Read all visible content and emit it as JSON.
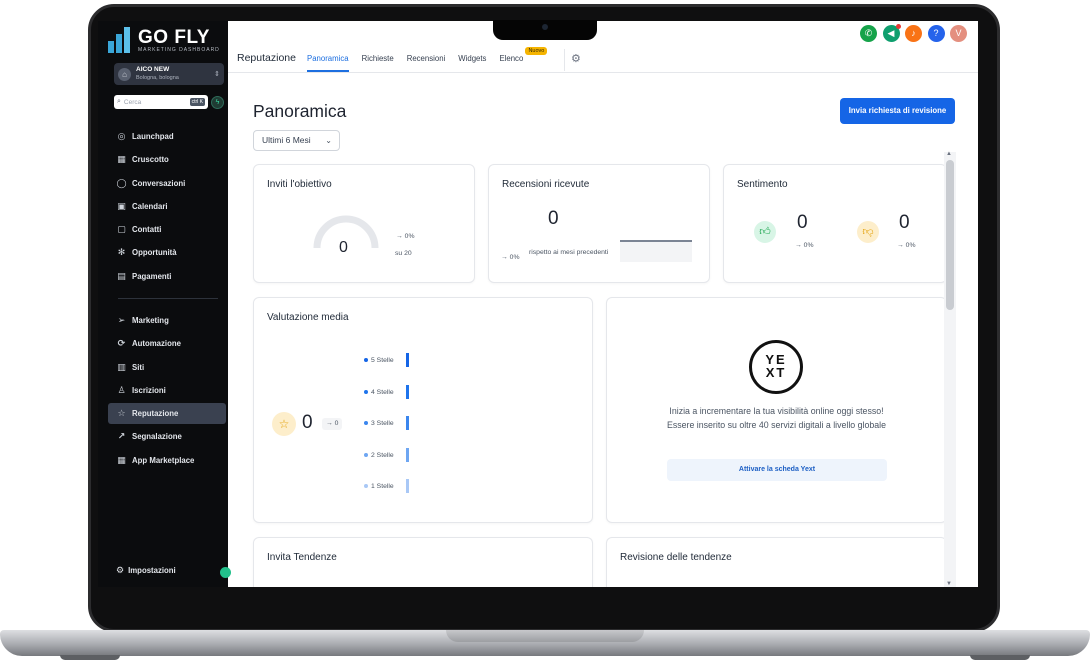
{
  "brand": {
    "title": "GO FLY",
    "subtitle": "MARKETING DASHBOARD"
  },
  "account": {
    "name": "AICO NEW",
    "location": "Bologna, bologna"
  },
  "search": {
    "placeholder": "Cerca",
    "shortcut": "ctrl K"
  },
  "sidebar": {
    "items": [
      {
        "label": "Launchpad",
        "icon": "launchpad-icon"
      },
      {
        "label": "Cruscotto",
        "icon": "dashboard-icon"
      },
      {
        "label": "Conversazioni",
        "icon": "chat-icon"
      },
      {
        "label": "Calendari",
        "icon": "calendar-icon"
      },
      {
        "label": "Contatti",
        "icon": "contacts-icon"
      },
      {
        "label": "Opportunità",
        "icon": "opportunity-icon"
      },
      {
        "label": "Pagamenti",
        "icon": "payments-icon"
      },
      {
        "label": "Marketing",
        "icon": "send-icon"
      },
      {
        "label": "Automazione",
        "icon": "automation-icon"
      },
      {
        "label": "Siti",
        "icon": "sites-icon"
      },
      {
        "label": "Iscrizioni",
        "icon": "memberships-icon"
      },
      {
        "label": "Reputazione",
        "icon": "star-icon",
        "active": true
      },
      {
        "label": "Segnalazione",
        "icon": "reporting-icon"
      },
      {
        "label": "App Marketplace",
        "icon": "apps-icon"
      }
    ],
    "settings_label": "Impostazioni"
  },
  "topbar": {
    "title": "Reputazione",
    "tabs": [
      {
        "label": "Panoramica",
        "active": true
      },
      {
        "label": "Richieste"
      },
      {
        "label": "Recensioni"
      },
      {
        "label": "Widgets"
      },
      {
        "label": "Elenco",
        "badge": "Nuovo"
      }
    ],
    "user_initial": "V"
  },
  "main": {
    "title": "Panoramica",
    "primary_button": "Invia richiesta di revisione",
    "period": "Ultimi 6 Mesi"
  },
  "cards": {
    "invites": {
      "title": "Inviti l'obiettivo",
      "value": "0",
      "delta": "→ 0%",
      "target": "su 20"
    },
    "reviews": {
      "title": "Recensioni ricevute",
      "value": "0",
      "delta": "→ 0%",
      "compare": "rispetto ai mesi precedenti"
    },
    "sentiment": {
      "title": "Sentimento",
      "positive_value": "0",
      "positive_delta": "→ 0%",
      "negative_value": "0",
      "negative_delta": "→ 0%"
    },
    "rating": {
      "title": "Valutazione media",
      "value": "0",
      "delta": "→ 0",
      "stars": [
        {
          "label": "5 Stelle",
          "color": "#1565e6"
        },
        {
          "label": "4 Stelle",
          "color": "#1e74ec"
        },
        {
          "label": "3 Stelle",
          "color": "#3b86ee"
        },
        {
          "label": "2 Stelle",
          "color": "#6ea6f2"
        },
        {
          "label": "1 Stelle",
          "color": "#a9c8f6"
        }
      ]
    },
    "yext": {
      "logo_line1": "YE",
      "logo_line2": "XT",
      "line1": "Inizia a incrementare la tua visibilità online oggi stesso!",
      "line2": "Essere inserito su oltre 40 servizi digitali a livello globale",
      "button": "Attivare la scheda Yext"
    },
    "invite_trends": {
      "title": "Invita Tendenze"
    },
    "review_trends": {
      "title": "Revisione delle tendenze"
    }
  },
  "colors": {
    "accent": "#1565e6",
    "sidebar_bg": "#0b0c0e",
    "active_nav": "#3a4150",
    "phone": "#16a34a",
    "megaphone": "#0f9f6e",
    "bell": "#f97316",
    "help": "#2563eb",
    "avatar": "#e48f7f"
  }
}
